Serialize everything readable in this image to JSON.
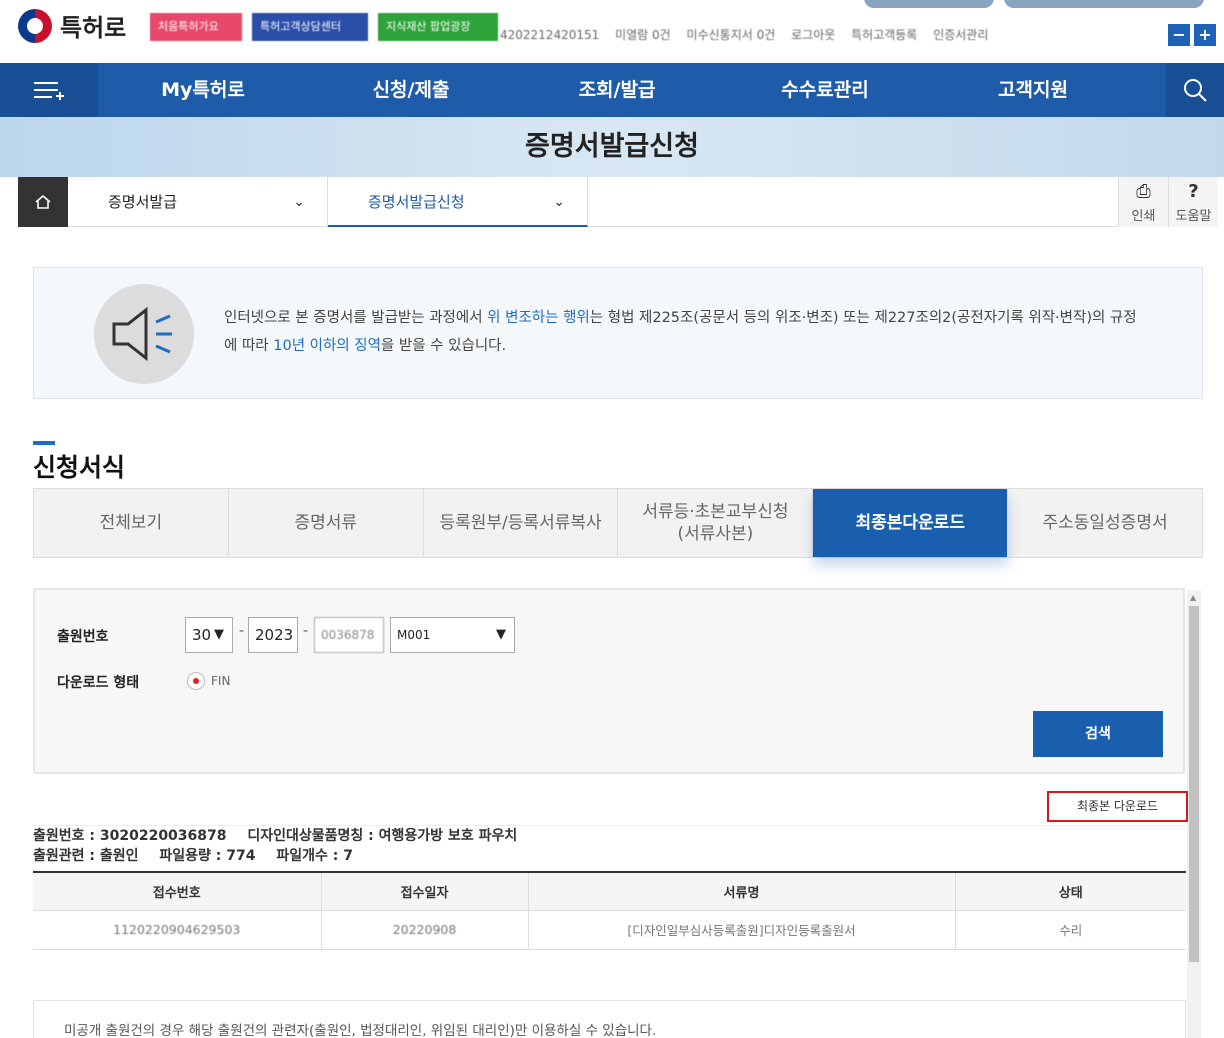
{
  "header": {
    "logo_text": "특허로",
    "badges": [
      "처음특허가요",
      "특허고객상담센터",
      "지식재산 팝업광장"
    ],
    "user_info": [
      "4202212420151",
      "미열람 0건",
      "미수신통지서 0건",
      "로그아웃",
      "특허고객등록",
      "인증서관리"
    ],
    "zoom_out": "−",
    "zoom_in": "+"
  },
  "nav": {
    "items": [
      "My특허로",
      "신청/제출",
      "조회/발급",
      "수수료관리",
      "고객지원"
    ]
  },
  "page_title": "증명서발급신청",
  "breadcrumb": {
    "level1": "증명서발급",
    "level2": "증명서발급신청",
    "print": "인쇄",
    "help": "도움말",
    "help_icon": "?"
  },
  "notice": {
    "t1": "인터넷으로 본 증명서를 발급받는 과정에서 ",
    "h1": "위 변조하는 행위",
    "t2": "는 형법 제225조(공문서 등의 위조·변조) 또는 제227조의2(공전자기록 위작·변작)의 규정에 따라 ",
    "h2": "10년 이하의 징역",
    "t3": "을 받을 수 있습니다."
  },
  "section_title": "신청서식",
  "tabs": [
    "전체보기",
    "증명서류",
    "등록원부/등록서류복사",
    "서류등·초본교부신청\n(서류사본)",
    "최종본다운로드",
    "주소동일성증명서"
  ],
  "form": {
    "app_no_label": "출원번호",
    "app_type": "30",
    "app_year": "2023",
    "app_serial": "0036878",
    "doc_code": "M001",
    "download_label": "다운로드 형태",
    "download_option": "FIN",
    "search_button": "검색"
  },
  "final_download_button": "최종본 다운로드",
  "result": {
    "line1_a": "출원번호 : 3020220036878",
    "line1_b": "디자인대상물품명칭 : 여행용가방 보호 파우치",
    "line2_a": "출원관련 : 출원인",
    "line2_b": "파일용량 : 774",
    "line2_c": "파일개수 : 7"
  },
  "table": {
    "headers": [
      "접수번호",
      "접수일자",
      "서류명",
      "상태"
    ],
    "rows": [
      [
        "1120220904629503",
        "20220908",
        "[디자인일부심사등록출원]디자인등록출원서",
        "수리"
      ]
    ]
  },
  "footnote": "미공개 출원건의 경우 해당 출원건의 관련자(출원인, 법정대리인, 위임된 대리인)만 이용하실 수 있습니다.",
  "colors": {
    "nav": "#1e5ba8",
    "active_tab": "#1a5fae",
    "highlight": "#d21c1c"
  }
}
